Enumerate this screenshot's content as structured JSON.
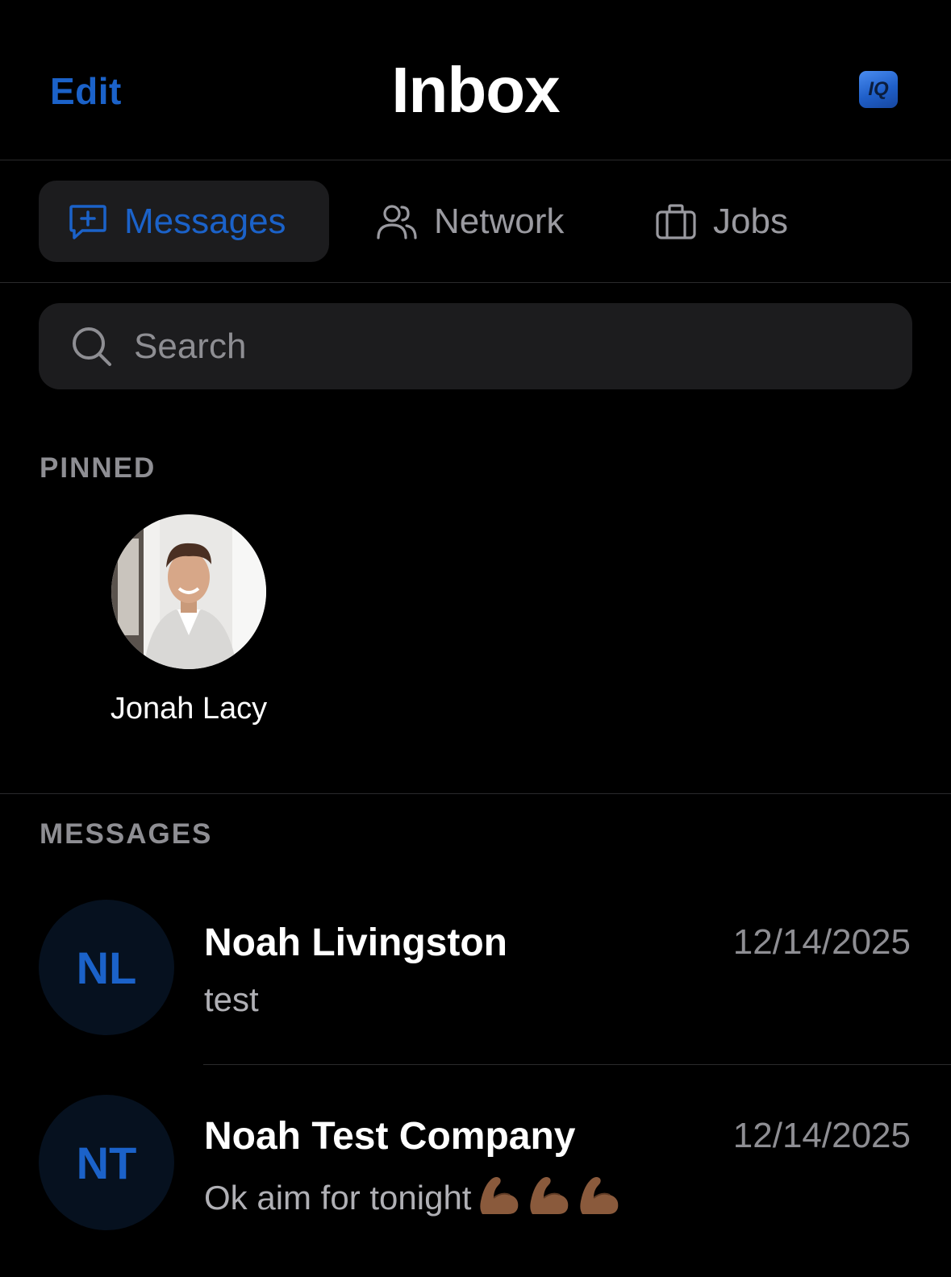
{
  "header": {
    "edit_label": "Edit",
    "title": "Inbox",
    "logo_text": "IQ"
  },
  "tabs": [
    {
      "label": "Messages",
      "icon": "message-plus-icon",
      "active": true
    },
    {
      "label": "Network",
      "icon": "people-icon",
      "active": false
    },
    {
      "label": "Jobs",
      "icon": "briefcase-icon",
      "active": false
    }
  ],
  "search": {
    "placeholder": "Search",
    "icon": "search-icon"
  },
  "pinned": {
    "section_label": "PINNED",
    "items": [
      {
        "name": "Jonah Lacy",
        "avatar": "photo"
      }
    ]
  },
  "messages": {
    "section_label": "MESSAGES",
    "items": [
      {
        "initials": "NL",
        "name": "Noah Livingston",
        "date": "12/14/2025",
        "preview": "test"
      },
      {
        "initials": "NT",
        "name": "Noah Test Company",
        "date": "12/14/2025",
        "preview": "Ok aim for tonight",
        "preview_emoji": [
          "flexed-biceps",
          "flexed-biceps",
          "flexed-biceps"
        ]
      }
    ]
  },
  "colors": {
    "accent": "#1b62c9",
    "background": "#000000",
    "surface": "#1c1c1e",
    "muted_text": "#8e8e93",
    "avatar_bg": "#06111f"
  }
}
